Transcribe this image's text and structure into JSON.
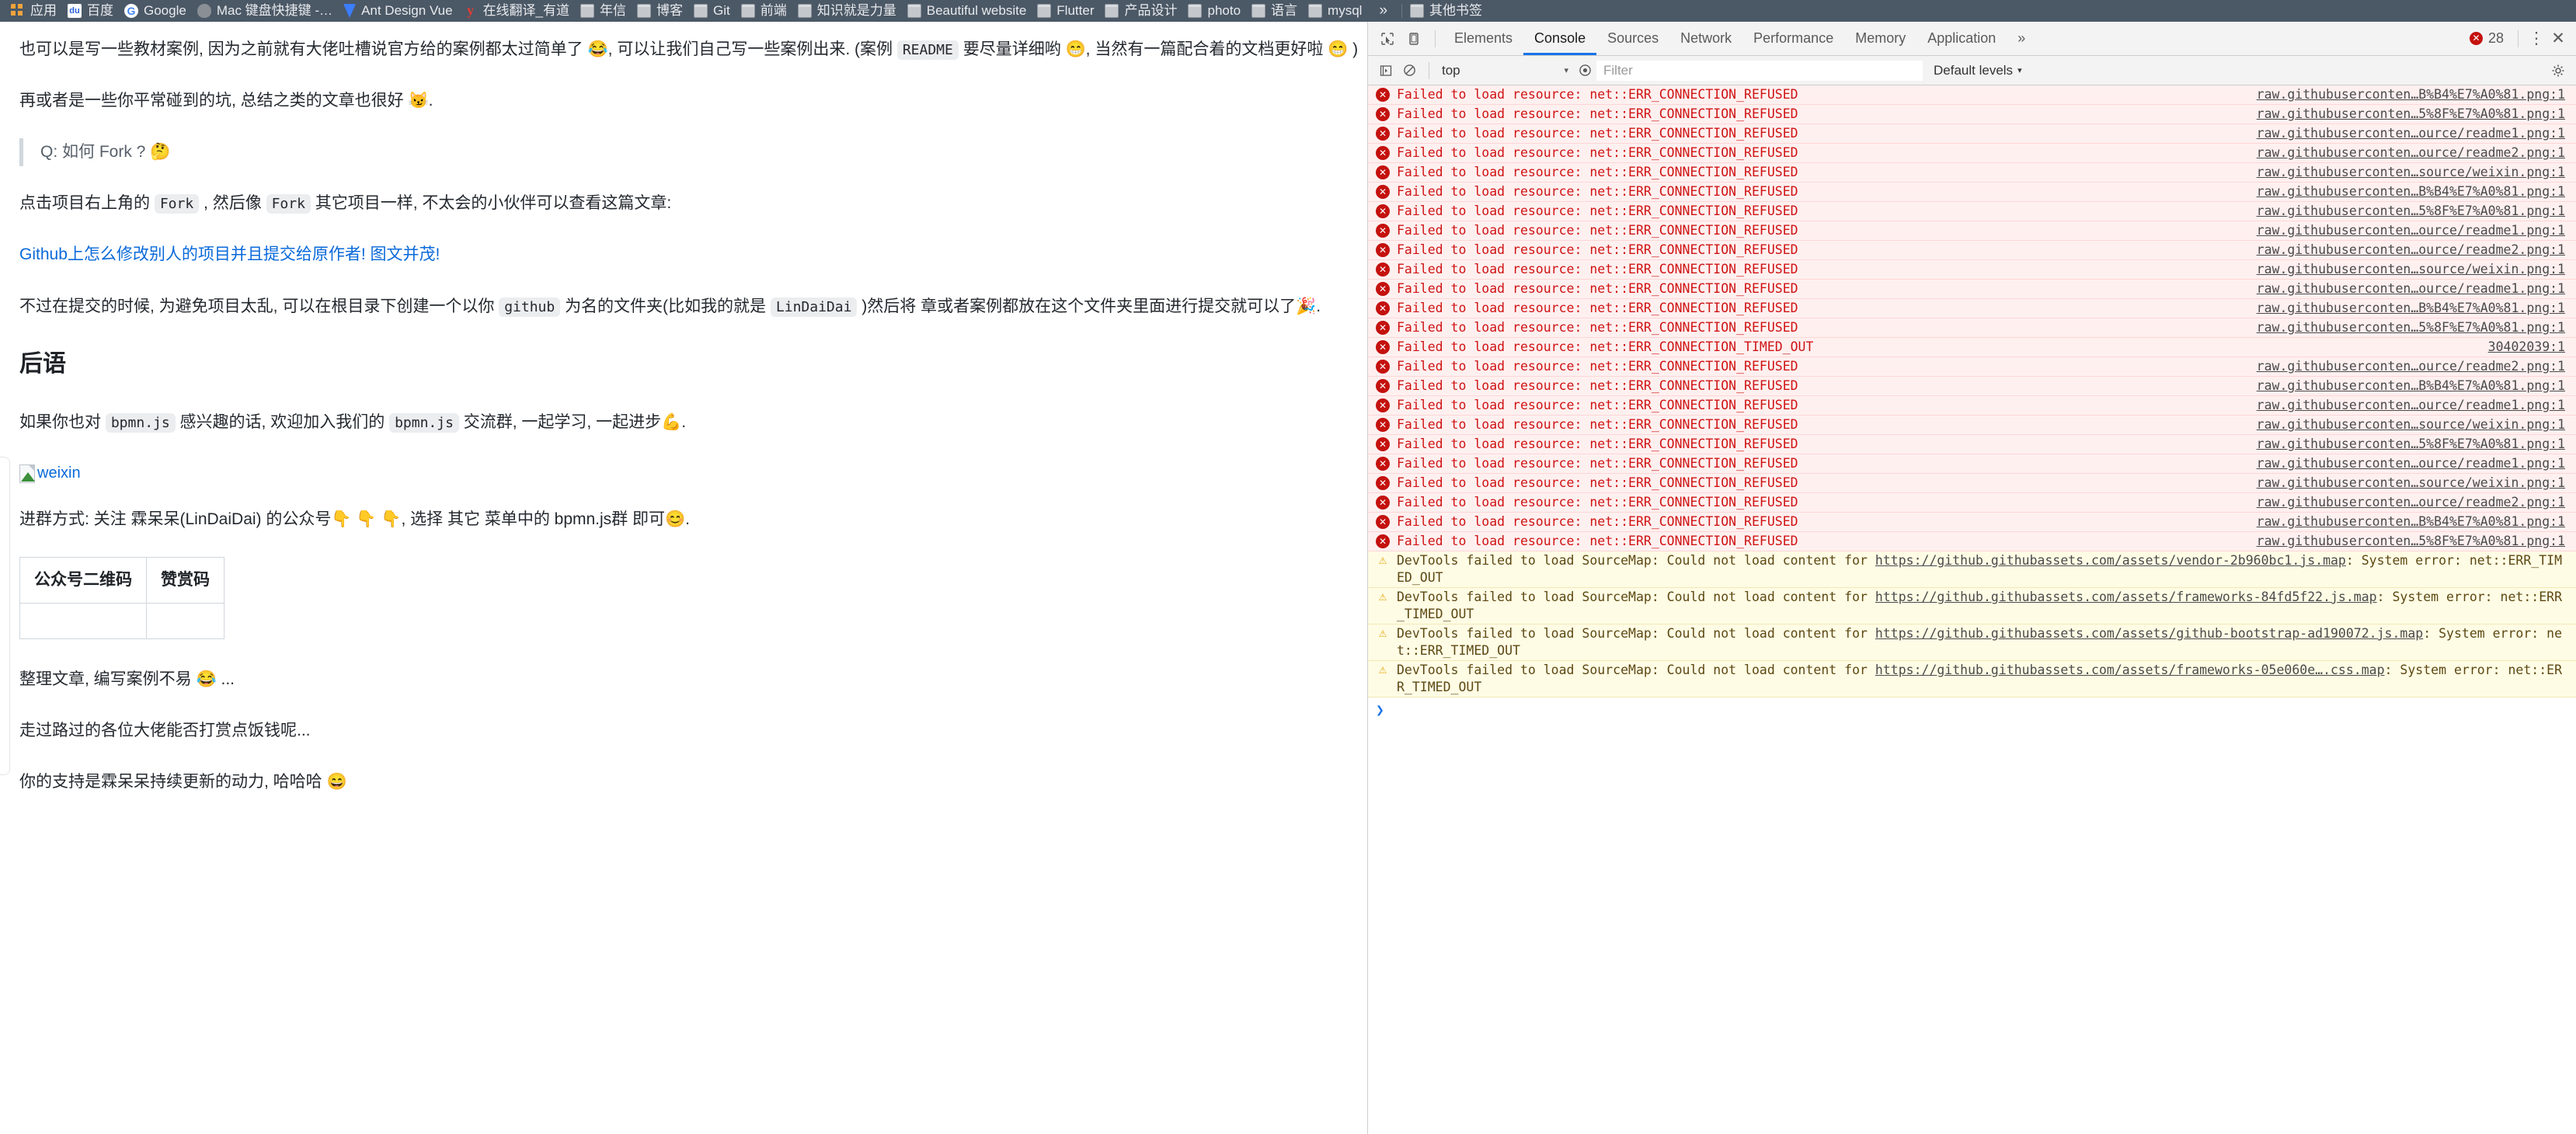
{
  "browser": {
    "bookmarks": [
      {
        "label": "应用",
        "icon": "apps-grid-icon"
      },
      {
        "label": "百度",
        "icon": "baidu-icon"
      },
      {
        "label": "Google",
        "icon": "google-icon"
      },
      {
        "label": "Mac 键盘快捷键 -…",
        "icon": "apple-icon"
      },
      {
        "label": "Ant Design Vue",
        "icon": "ant-design-icon"
      },
      {
        "label": "在线翻译_有道",
        "icon": "youdao-icon"
      },
      {
        "label": "年信",
        "icon": "folder-icon"
      },
      {
        "label": "博客",
        "icon": "folder-icon"
      },
      {
        "label": "Git",
        "icon": "folder-icon"
      },
      {
        "label": "前端",
        "icon": "folder-icon"
      },
      {
        "label": "知识就是力量",
        "icon": "folder-icon"
      },
      {
        "label": "Beautiful website",
        "icon": "folder-icon"
      },
      {
        "label": "Flutter",
        "icon": "folder-icon"
      },
      {
        "label": "产品设计",
        "icon": "folder-icon"
      },
      {
        "label": "photo",
        "icon": "folder-icon"
      },
      {
        "label": "语言",
        "icon": "folder-icon"
      },
      {
        "label": "mysql",
        "icon": "folder-icon"
      }
    ],
    "overflow_label": "»",
    "other_bookmarks": {
      "label": "其他书签",
      "icon": "folder-icon"
    }
  },
  "article": {
    "p1_a": "也可以是写一些教材案例, 因为之前就有大佬吐槽说官方给的案例都太过简单了 😂, 可以让我们自己写一些案例出来. (案例",
    "p1_code": "README",
    "p1_b": "要尽量详细哟 😁, 当然有一篇配合着的文档更好啦 😁 )",
    "p2": "再或者是一些你平常碰到的坑, 总结之类的文章也很好 😼.",
    "blockquote": "Q: 如何 Fork ? 🤔",
    "p3_a": "点击项目右上角的",
    "p3_code1": "Fork",
    "p3_b": ", 然后像",
    "p3_code2": "Fork",
    "p3_c": "其它项目一样, 不太会的小伙伴可以查看这篇文章:",
    "link": "Github上怎么修改别人的项目并且提交给原作者! 图文并茂!",
    "p4_a": "不过在提交的时候, 为避免项目太乱, 可以在根目录下创建一个以你",
    "p4_code1": "github",
    "p4_b": "为名的文件夹(比如我的就是",
    "p4_code2": "LinDaiDai",
    "p4_c": ")然后将",
    "p4_d": "章或者案例都放在这个文件夹里面进行提交就可以了🎉.",
    "heading": "后语",
    "p5_a": "如果你也对",
    "p5_code1": "bpmn.js",
    "p5_b": "感兴趣的话, 欢迎加入我们的",
    "p5_code2": "bpmn.js",
    "p5_c": "交流群, 一起学习, 一起进步💪.",
    "broken_image_alt": "weixin",
    "p6": "进群方式: 关注 霖呆呆(LinDaiDai) 的公众号👇 👇 👇, 选择 其它 菜单中的 bpmn.js群 即可😊.",
    "table": {
      "headers": [
        "公众号二维码",
        "赞赏码"
      ],
      "rows": [
        [
          "",
          ""
        ]
      ]
    },
    "p7": "整理文章, 编写案例不易 😂 ...",
    "p8": "走过路过的各位大佬能否打赏点饭钱呢...",
    "p9": "你的支持是霖呆呆持续更新的动力, 哈哈哈 😄"
  },
  "devtools": {
    "tabs": [
      {
        "label": "Elements",
        "active": false
      },
      {
        "label": "Console",
        "active": true
      },
      {
        "label": "Sources",
        "active": false
      },
      {
        "label": "Network",
        "active": false
      },
      {
        "label": "Performance",
        "active": false
      },
      {
        "label": "Memory",
        "active": false
      },
      {
        "label": "Application",
        "active": false
      }
    ],
    "more_tabs_label": "»",
    "error_count": "28",
    "kebab_label": "⋮",
    "close_label": "✕",
    "toolbar": {
      "context_value": "top",
      "context_caret": "▾",
      "filter_placeholder": "Filter",
      "filter_value": "",
      "levels_label": "Default levels",
      "levels_caret": "▾"
    },
    "prompt_chevron": "❯",
    "messages": [
      {
        "type": "error",
        "text": "Failed to load resource: net::ERR_CONNECTION_REFUSED",
        "source": "raw.githubuserconten…B%B4%E7%A0%81.png:1"
      },
      {
        "type": "error",
        "text": "Failed to load resource: net::ERR_CONNECTION_REFUSED",
        "source": "raw.githubuserconten…5%8F%E7%A0%81.png:1"
      },
      {
        "type": "error",
        "text": "Failed to load resource: net::ERR_CONNECTION_REFUSED",
        "source": "raw.githubuserconten…ource/readme1.png:1"
      },
      {
        "type": "error",
        "text": "Failed to load resource: net::ERR_CONNECTION_REFUSED",
        "source": "raw.githubuserconten…ource/readme2.png:1"
      },
      {
        "type": "error",
        "text": "Failed to load resource: net::ERR_CONNECTION_REFUSED",
        "source": "raw.githubuserconten…source/weixin.png:1"
      },
      {
        "type": "error",
        "text": "Failed to load resource: net::ERR_CONNECTION_REFUSED",
        "source": "raw.githubuserconten…B%B4%E7%A0%81.png:1"
      },
      {
        "type": "error",
        "text": "Failed to load resource: net::ERR_CONNECTION_REFUSED",
        "source": "raw.githubuserconten…5%8F%E7%A0%81.png:1"
      },
      {
        "type": "error",
        "text": "Failed to load resource: net::ERR_CONNECTION_REFUSED",
        "source": "raw.githubuserconten…ource/readme1.png:1"
      },
      {
        "type": "error",
        "text": "Failed to load resource: net::ERR_CONNECTION_REFUSED",
        "source": "raw.githubuserconten…ource/readme2.png:1"
      },
      {
        "type": "error",
        "text": "Failed to load resource: net::ERR_CONNECTION_REFUSED",
        "source": "raw.githubuserconten…source/weixin.png:1"
      },
      {
        "type": "error",
        "text": "Failed to load resource: net::ERR_CONNECTION_REFUSED",
        "source": "raw.githubuserconten…ource/readme1.png:1"
      },
      {
        "type": "error",
        "text": "Failed to load resource: net::ERR_CONNECTION_REFUSED",
        "source": "raw.githubuserconten…B%B4%E7%A0%81.png:1"
      },
      {
        "type": "error",
        "text": "Failed to load resource: net::ERR_CONNECTION_REFUSED",
        "source": "raw.githubuserconten…5%8F%E7%A0%81.png:1"
      },
      {
        "type": "error",
        "text": "Failed to load resource: net::ERR_CONNECTION_TIMED_OUT",
        "source": "30402039:1"
      },
      {
        "type": "error",
        "text": "Failed to load resource: net::ERR_CONNECTION_REFUSED",
        "source": "raw.githubuserconten…ource/readme2.png:1"
      },
      {
        "type": "error",
        "text": "Failed to load resource: net::ERR_CONNECTION_REFUSED",
        "source": "raw.githubuserconten…B%B4%E7%A0%81.png:1"
      },
      {
        "type": "error",
        "text": "Failed to load resource: net::ERR_CONNECTION_REFUSED",
        "source": "raw.githubuserconten…ource/readme1.png:1"
      },
      {
        "type": "error",
        "text": "Failed to load resource: net::ERR_CONNECTION_REFUSED",
        "source": "raw.githubuserconten…source/weixin.png:1"
      },
      {
        "type": "error",
        "text": "Failed to load resource: net::ERR_CONNECTION_REFUSED",
        "source": "raw.githubuserconten…5%8F%E7%A0%81.png:1"
      },
      {
        "type": "error",
        "text": "Failed to load resource: net::ERR_CONNECTION_REFUSED",
        "source": "raw.githubuserconten…ource/readme1.png:1"
      },
      {
        "type": "error",
        "text": "Failed to load resource: net::ERR_CONNECTION_REFUSED",
        "source": "raw.githubuserconten…source/weixin.png:1"
      },
      {
        "type": "error",
        "text": "Failed to load resource: net::ERR_CONNECTION_REFUSED",
        "source": "raw.githubuserconten…ource/readme2.png:1"
      },
      {
        "type": "error",
        "text": "Failed to load resource: net::ERR_CONNECTION_REFUSED",
        "source": "raw.githubuserconten…B%B4%E7%A0%81.png:1"
      },
      {
        "type": "error",
        "text": "Failed to load resource: net::ERR_CONNECTION_REFUSED",
        "source": "raw.githubuserconten…5%8F%E7%A0%81.png:1"
      },
      {
        "type": "warn",
        "text_prefix": "DevTools failed to load SourceMap: Could not load content for ",
        "link": "https://github.githubassets.com/assets/vendor-2b960bc1.js.map",
        "text_suffix": ": System error: net::ERR_TIMED_OUT"
      },
      {
        "type": "warn",
        "text_prefix": "DevTools failed to load SourceMap: Could not load content for ",
        "link": "https://github.githubassets.com/assets/frameworks-84fd5f22.js.map",
        "text_suffix": ": System error: net::ERR_TIMED_OUT"
      },
      {
        "type": "warn",
        "text_prefix": "DevTools failed to load SourceMap: Could not load content for ",
        "link": "https://github.githubassets.com/assets/github-bootstrap-ad190072.js.map",
        "text_suffix": ": System error: net::ERR_TIMED_OUT"
      },
      {
        "type": "warn",
        "text_prefix": "DevTools failed to load SourceMap: Could not load content for ",
        "link": "https://github.githubassets.com/assets/frameworks-05e060e….css.map",
        "text_suffix": ": System error: net::ERR_TIMED_OUT"
      }
    ]
  }
}
